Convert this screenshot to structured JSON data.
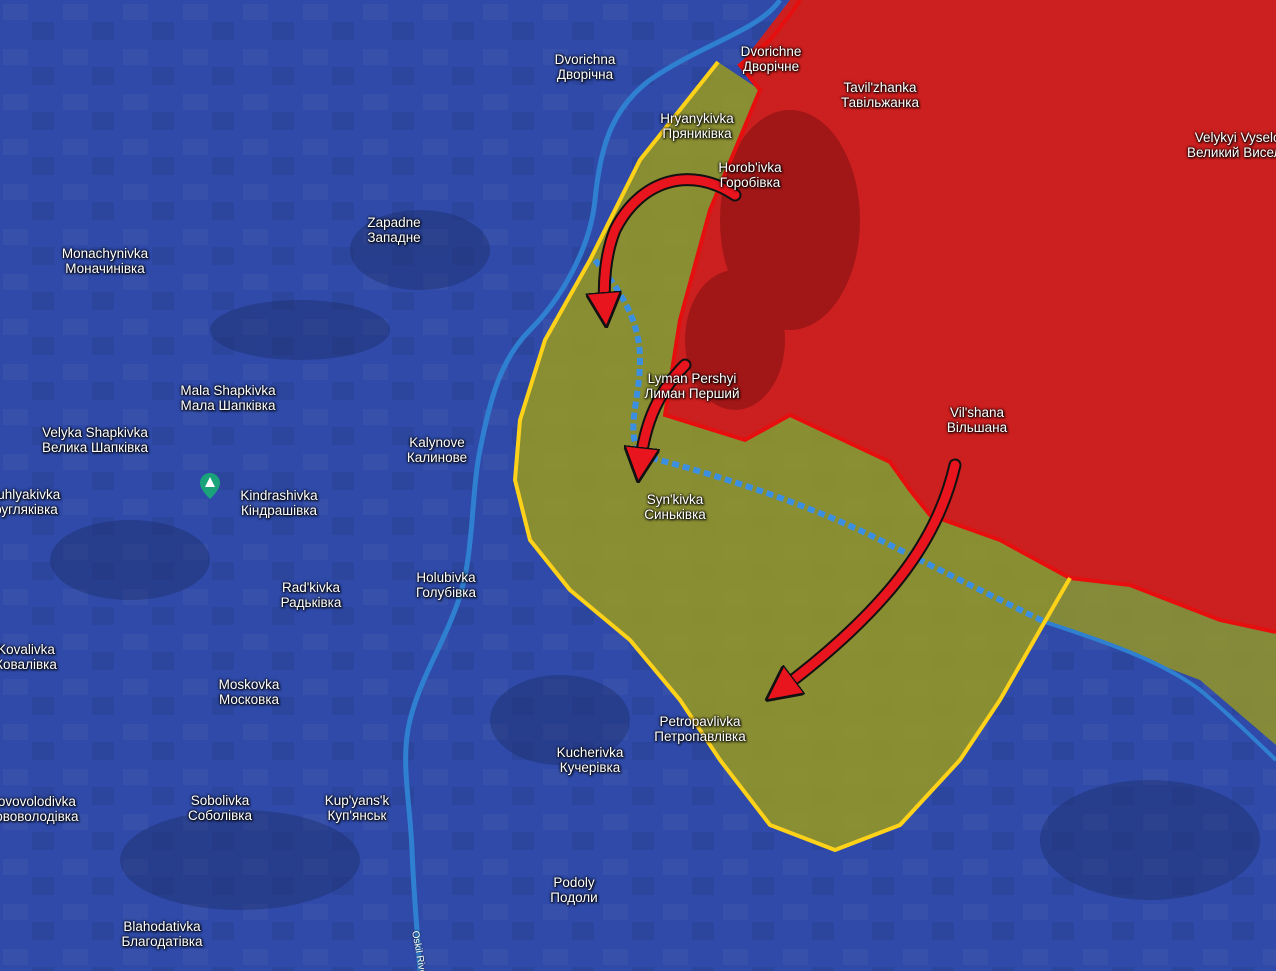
{
  "colors": {
    "ukraine_zone": "#2f4aa8",
    "russia_zone": "#cc1f1f",
    "contested_zone": "#9a9a1e",
    "frontline": "#e60f0f",
    "river": "#2f80d0",
    "salient_outline": "#ffd21a",
    "attack_arrow": "#e8141e",
    "dotted_line": "#3b8fe0"
  },
  "icons": {
    "poi": "campground-pin-icon"
  },
  "places": [
    {
      "id": "dvorichna",
      "lat": "Dvorichna",
      "cyr": "Дворічна"
    },
    {
      "id": "dvorichne",
      "lat": "Dvorichne",
      "cyr": "Дворічне"
    },
    {
      "id": "tavilzhanka",
      "lat": "Tavil'zhanka",
      "cyr": "Тавільжанка"
    },
    {
      "id": "hryanykivka",
      "lat": "Hryanykivka",
      "cyr": "Пряниківка"
    },
    {
      "id": "horobivka",
      "lat": "Horob'ivka",
      "cyr": "Горобівка"
    },
    {
      "id": "velykyi-vyselok",
      "lat": "Velykyi Vyselok",
      "cyr": "Великий Виселок"
    },
    {
      "id": "zapadne",
      "lat": "Zapadne",
      "cyr": "Западне"
    },
    {
      "id": "monachynivka",
      "lat": "Monachynivka",
      "cyr": "Моначинівка"
    },
    {
      "id": "mala-shapkivka",
      "lat": "Mala Shapkivka",
      "cyr": "Мала Шапківка"
    },
    {
      "id": "velyka-shapkivka",
      "lat": "Velyka Shapkivka",
      "cyr": "Велика Шапківка"
    },
    {
      "id": "kindrashivka",
      "lat": "Kindrashivka",
      "cyr": "Кіндрашівка"
    },
    {
      "id": "kalynove",
      "lat": "Kalynove",
      "cyr": "Калинове"
    },
    {
      "id": "lyman-pershyi",
      "lat": "Lyman Pershyi",
      "cyr": "Лиман Перший"
    },
    {
      "id": "vilshana",
      "lat": "Vil'shana",
      "cyr": "Вільшана"
    },
    {
      "id": "synkivka",
      "lat": "Syn'kivka",
      "cyr": "Синьківка"
    },
    {
      "id": "radkivka",
      "lat": "Rad'kivka",
      "cyr": "Радьківка"
    },
    {
      "id": "holubivka",
      "lat": "Holubivka",
      "cyr": "Голубівка"
    },
    {
      "id": "petropavlivka",
      "lat": "Petropavlivka",
      "cyr": "Петропавлівка"
    },
    {
      "id": "moskovka",
      "lat": "Moskovka",
      "cyr": "Московка"
    },
    {
      "id": "kucherivka",
      "lat": "Kucherivka",
      "cyr": "Кучерівка"
    },
    {
      "id": "sobolivka",
      "lat": "Sobolivka",
      "cyr": "Соболівка"
    },
    {
      "id": "kupyansk",
      "lat": "Kup'yans'k",
      "cyr": "Куп'янськ"
    },
    {
      "id": "podoly",
      "lat": "Podoly",
      "cyr": "Подоли"
    },
    {
      "id": "blahodativka",
      "lat": "Blahodativka",
      "cyr": "Благодатівка"
    },
    {
      "id": "kovalivka",
      "lat": "Kovalivka",
      "cyr": "Ковалівка"
    },
    {
      "id": "novovolodivka",
      "lat": "Novovolodivka",
      "cyr": "Нововолодівка"
    },
    {
      "id": "kruhlyakivka",
      "lat": "Kruhlyakivka",
      "cyr": "Кругляківка"
    }
  ],
  "river_label": "Oskil River"
}
